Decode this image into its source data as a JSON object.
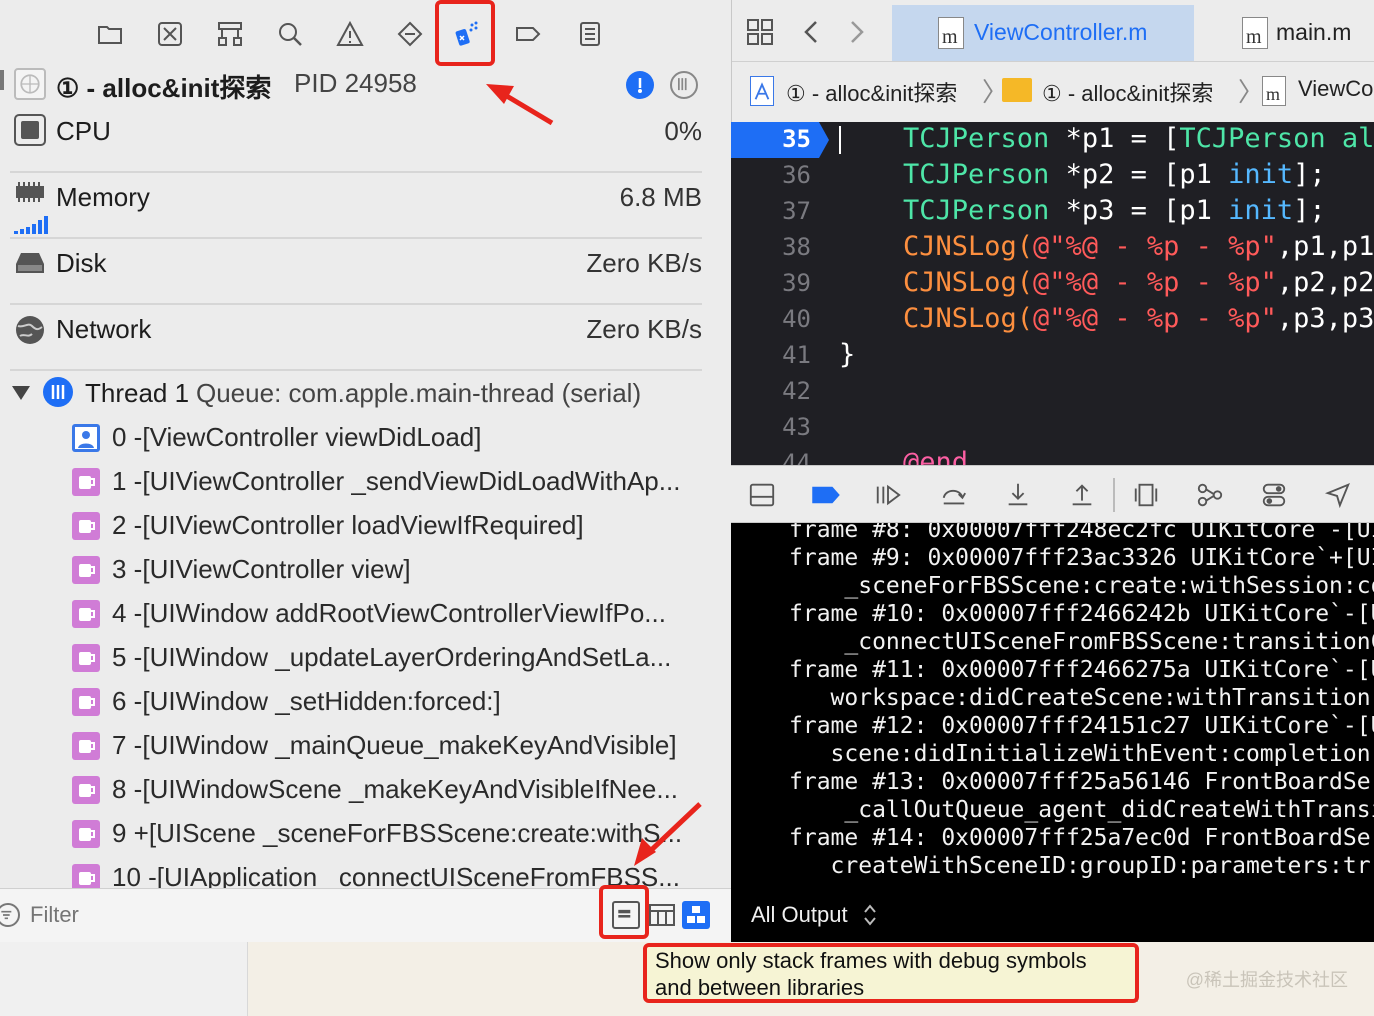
{
  "navigator": {
    "process": {
      "name": "① - alloc&init探索",
      "pid": "PID 24958"
    },
    "gauges": [
      {
        "label": "CPU",
        "value": "0%"
      },
      {
        "label": "Memory",
        "value": "6.8 MB"
      },
      {
        "label": "Disk",
        "value": "Zero KB/s"
      },
      {
        "label": "Network",
        "value": "Zero KB/s"
      }
    ],
    "thread": {
      "name": "Thread 1",
      "queue": "Queue: com.apple.main-thread (serial)"
    },
    "frames": [
      "0 -[ViewController viewDidLoad]",
      "1 -[UIViewController _sendViewDidLoadWithAp...",
      "2 -[UIViewController loadViewIfRequired]",
      "3 -[UIViewController view]",
      "4 -[UIWindow addRootViewControllerViewIfPo...",
      "5 -[UIWindow _updateLayerOrderingAndSetLa...",
      "6 -[UIWindow _setHidden:forced:]",
      "7 -[UIWindow _mainQueue_makeKeyAndVisible]",
      "8 -[UIWindowScene _makeKeyAndVisibleIfNee...",
      "9 +[UIScene _sceneForFBSScene:create:withS...",
      "10 -[UIApplication _connectUISceneFromFBSS..."
    ],
    "filter_placeholder": "Filter"
  },
  "editor": {
    "tabs": [
      {
        "label": "ViewController.m",
        "active": true
      },
      {
        "label": "main.m",
        "active": false
      }
    ],
    "jump_bar": [
      "① - alloc&init探索",
      "① - alloc&init探索",
      "ViewCo"
    ],
    "code_lines": [
      {
        "n": "35",
        "segments": [
          [
            "TCJPerson",
            "#4ee6a8"
          ],
          [
            " *p1 = ",
            "#ffffff"
          ],
          [
            "[",
            "#ffffff"
          ],
          [
            "TCJPerson al",
            "#4ee6a8"
          ]
        ]
      },
      {
        "n": "36",
        "segments": [
          [
            "TCJPerson",
            "#4ee6a8"
          ],
          [
            " *p2 = [p1 ",
            "#ffffff"
          ],
          [
            "init",
            "#55b8ff"
          ],
          [
            "];",
            "#ffffff"
          ]
        ]
      },
      {
        "n": "37",
        "segments": [
          [
            "TCJPerson",
            "#4ee6a8"
          ],
          [
            " *p3 = [p1 ",
            "#ffffff"
          ],
          [
            "init",
            "#55b8ff"
          ],
          [
            "];",
            "#ffffff"
          ]
        ]
      },
      {
        "n": "38",
        "segments": [
          [
            "CJNSLog(",
            "#fd8f3f"
          ],
          [
            "@\"%@ - %p - %p\"",
            "#ff5a5a"
          ],
          [
            ",p1,p1",
            "#ffffff"
          ]
        ]
      },
      {
        "n": "39",
        "segments": [
          [
            "CJNSLog(",
            "#fd8f3f"
          ],
          [
            "@\"%@ - %p - %p\"",
            "#ff5a5a"
          ],
          [
            ",p2,p2",
            "#ffffff"
          ]
        ]
      },
      {
        "n": "40",
        "segments": [
          [
            "CJNSLog(",
            "#fd8f3f"
          ],
          [
            "@\"%@ - %p - %p\"",
            "#ff5a5a"
          ],
          [
            ",p3,p3",
            "#ffffff"
          ]
        ]
      },
      {
        "n": "41",
        "segments": [
          [
            "}",
            "#ffffff"
          ]
        ]
      },
      {
        "n": "42",
        "segments": []
      },
      {
        "n": "43",
        "segments": []
      },
      {
        "n": "44",
        "segments": [
          [
            "@end",
            "#fc5fa3"
          ]
        ]
      }
    ],
    "current_line": "35"
  },
  "console": {
    "lines": [
      "frame #8: 0x00007fff248ec2fc UIKitCore -[UI",
      "frame #9: 0x00007fff23ac3326 UIKitCore`+[UI",
      "    _sceneForFBSScene:create:withSession:co",
      "frame #10: 0x00007fff2466242b UIKitCore`-[U",
      "    _connectUISceneFromFBSScene:transitionC",
      "frame #11: 0x00007fff2466275a UIKitCore`-[U",
      "   workspace:didCreateScene:withTransition",
      "frame #12: 0x00007fff24151c27 UIKitCore`-[U",
      "   scene:didInitializeWithEvent:completion",
      "frame #13: 0x00007fff25a56146 FrontBoardSer",
      "    _callOutQueue_agent_didCreateWithTransi",
      "frame #14: 0x00007fff25a7ec0d FrontBoardSer",
      "   createWithSceneID:groupID:parameters:tr"
    ],
    "output_selector": "All Output"
  },
  "tooltip": {
    "line1": "Show only stack frames with debug symbols",
    "line2": "and between libraries"
  },
  "watermark": "@稀土掘金技术社区",
  "colors": {
    "accent": "#1e6ef5",
    "annotation": "#e8241c",
    "frame_icon_app": "#3a78e8",
    "frame_icon_lib": "#d07cd6"
  }
}
